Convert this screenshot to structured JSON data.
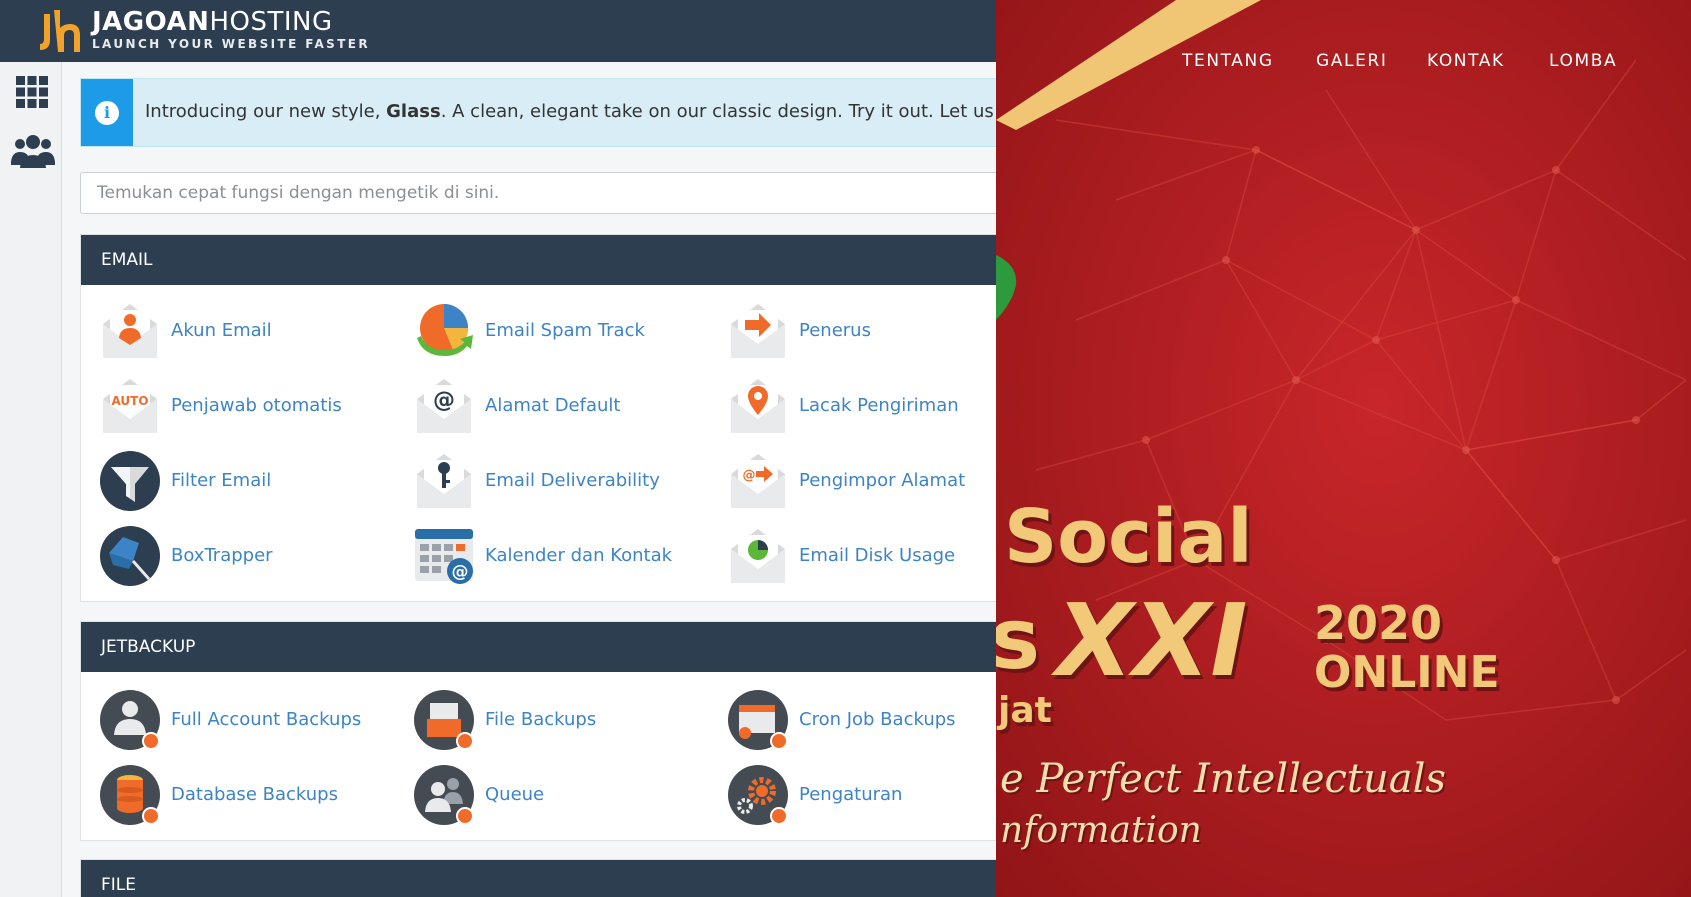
{
  "brand": {
    "name_bold": "JAGOAN",
    "name_rest": "HOSTING",
    "tagline": "LAUNCH YOUR WEBSITE FASTER"
  },
  "notice": {
    "before": "Introducing our new style, ",
    "strong": "Glass",
    "after": ". A clean, elegant take on our classic design. Try it out. Let us know what y"
  },
  "search": {
    "placeholder": "Temukan cepat fungsi dengan mengetik di sini."
  },
  "email": {
    "title": "EMAIL",
    "items": [
      "Akun Email",
      "Email Spam Track",
      "Penerus",
      "Penjawab otomatis",
      "Alamat Default",
      "Lacak Pengiriman",
      "Filter Email",
      "Email Deliverability",
      "Pengimpor Alamat",
      "BoxTrapper",
      "Kalender dan Kontak",
      "Email Disk Usage"
    ],
    "icons": [
      "account-envelope-icon",
      "spam-pie-chart-icon",
      "forwarder-envelope-icon",
      "autoresponder-envelope-icon",
      "default-address-envelope-icon",
      "track-delivery-envelope-icon",
      "funnel-filter-icon",
      "key-envelope-icon",
      "address-importer-envelope-icon",
      "boxtrapper-icon",
      "calendar-contacts-icon",
      "disk-usage-envelope-icon"
    ],
    "auto_badge": "AUTO"
  },
  "jetbackup": {
    "title": "JETBACKUP",
    "items": [
      "Full Account Backups",
      "File Backups",
      "Cron Job Backups",
      "Database Backups",
      "Queue",
      "Pengaturan"
    ],
    "icons": [
      "full-account-backup-icon",
      "file-backup-icon",
      "cron-job-backup-icon",
      "database-backup-icon",
      "queue-icon",
      "settings-gear-icon"
    ]
  },
  "file": {
    "title": "FILE"
  },
  "banner": {
    "nav": [
      "TENTANG",
      "GALERI",
      "KONTAK",
      "LOMBA"
    ],
    "line1": "Social",
    "line2a": "s",
    "line2b": "XXI",
    "year": "2020",
    "online": "ONLINE",
    "line3": "jat",
    "slogan1": "e Perfect Intellectuals",
    "slogan2": "nformation",
    "colors": {
      "background": "#b01d1f",
      "gold": "#f2c879"
    }
  },
  "colors": {
    "header": "#2c3e50",
    "link": "#3d84c6",
    "info_accent": "#1e9be8",
    "info_bg": "#d9edf7"
  }
}
